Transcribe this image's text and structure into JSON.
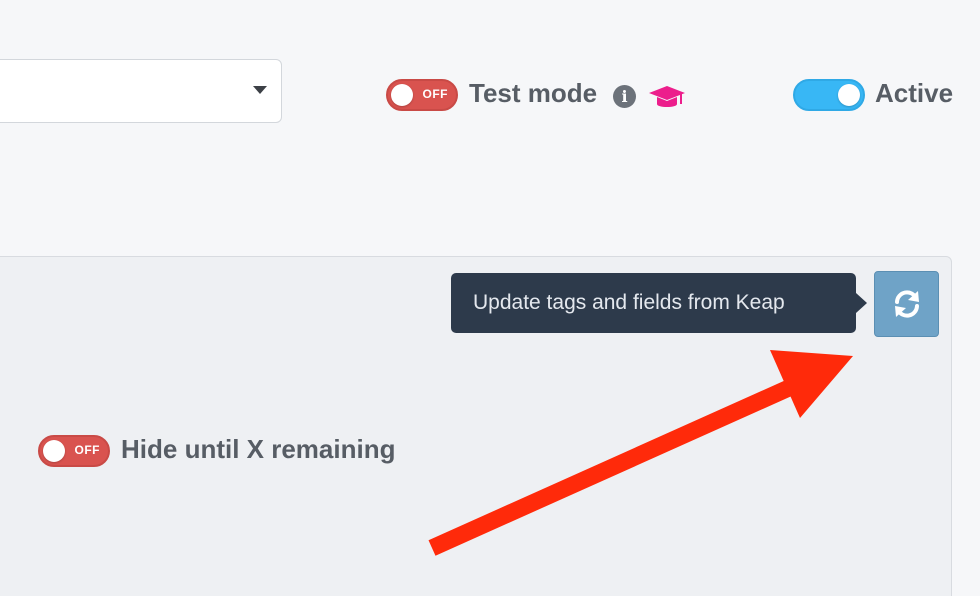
{
  "header": {
    "select_value": "",
    "test_mode": {
      "toggle_text": "OFF",
      "label": "Test mode",
      "info_icon": "info-icon",
      "tutorial_icon": "graduation-cap-icon",
      "tutorial_icon_color": "#ec1e8c"
    },
    "active": {
      "label": "Active",
      "state": "on",
      "color": "#38b7f5"
    }
  },
  "panel": {
    "tooltip_text": "Update tags and fields from Keap",
    "refresh_button_icon": "refresh-icon",
    "hide_until": {
      "toggle_text": "OFF",
      "label": "Hide until X remaining"
    }
  },
  "annotation": {
    "arrow_color": "#ff2a0a"
  }
}
